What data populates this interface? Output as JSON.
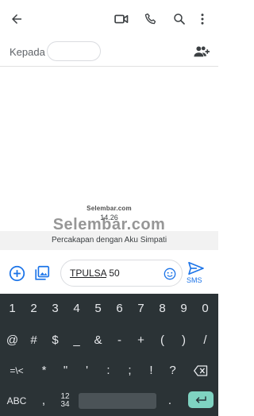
{
  "toolbar": {
    "back_icon": "arrow-back-icon",
    "video_icon": "video-call-icon",
    "call_icon": "phone-icon",
    "search_icon": "search-icon",
    "more_icon": "more-vert-icon"
  },
  "to_bar": {
    "label": "Kepada",
    "add_people_icon": "add-people-icon"
  },
  "conversation": {
    "watermark_small": "Selembar.com",
    "timestamp": "14.26",
    "watermark_big": "Selembar.com",
    "conversation_with": "Percakapan dengan Aku Simpati"
  },
  "compose": {
    "message_keyword": "TPULSA",
    "message_rest": " 50",
    "send_label": "SMS",
    "accent": "#1a73e8"
  },
  "keyboard": {
    "row1": [
      "1",
      "2",
      "3",
      "4",
      "5",
      "6",
      "7",
      "8",
      "9",
      "0"
    ],
    "row2": [
      "@",
      "#",
      "$",
      "_",
      "&",
      "-",
      "+",
      "(",
      ")",
      "/"
    ],
    "row3": [
      "=\\<",
      "*",
      "\"",
      "'",
      ":",
      ";",
      "!",
      "?"
    ],
    "row4": {
      "abc": "ABC",
      "comma": ",",
      "numpad_top": "12",
      "numpad_bottom": "34",
      "period": "."
    },
    "background": "#2b3336",
    "enter_color": "#7fd3c1"
  }
}
